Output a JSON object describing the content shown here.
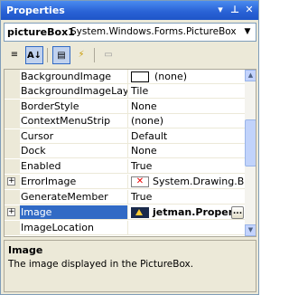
{
  "window": {
    "title": "Properties",
    "dropdown_glyph": "▾",
    "pin_glyph": "⊥",
    "close_glyph": "✕"
  },
  "object_selector": {
    "name": "pictureBox1",
    "type": "System.Windows.Forms.PictureBox",
    "drop_glyph": "▼"
  },
  "toolbar": {
    "categorized_glyph": "≡",
    "alphabetical_glyph": "A↓",
    "properties_glyph": "▤",
    "events_glyph": "⚡",
    "pages_glyph": "▭"
  },
  "grid": {
    "rows": [
      {
        "name": "BackgroundImage",
        "value": "(none)"
      },
      {
        "name": "BackgroundImageLayout",
        "value": "Tile"
      },
      {
        "name": "BorderStyle",
        "value": "None"
      },
      {
        "name": "ContextMenuStrip",
        "value": "(none)"
      },
      {
        "name": "Cursor",
        "value": "Default"
      },
      {
        "name": "Dock",
        "value": "None"
      },
      {
        "name": "Enabled",
        "value": "True"
      },
      {
        "name": "ErrorImage",
        "value": "System.Drawing.Bitm"
      },
      {
        "name": "GenerateMember",
        "value": "True"
      },
      {
        "name": "Image",
        "value": "jetman.Proper"
      },
      {
        "name": "ImageLocation",
        "value": ""
      }
    ],
    "expander_glyph": "+",
    "error_icon_glyph": "✕",
    "ellipsis_label": "...",
    "scroll_up_glyph": "▲",
    "scroll_down_glyph": "▼"
  },
  "description": {
    "title": "Image",
    "text": "The image displayed in the PictureBox."
  },
  "colors": {
    "selection": "#316ac5",
    "titlebar": "#2a63d6"
  }
}
